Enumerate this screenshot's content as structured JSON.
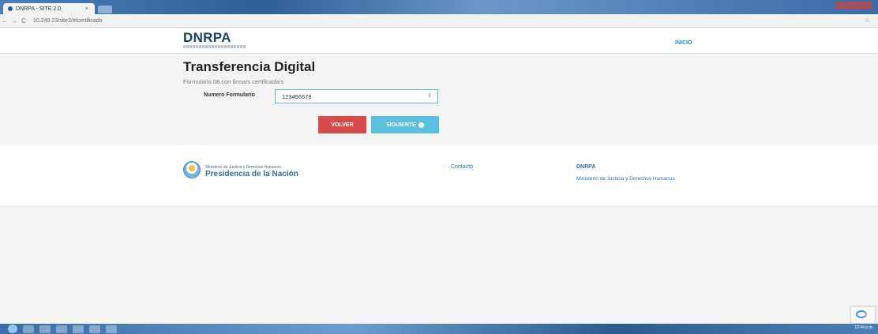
{
  "browser": {
    "tab_title": "DNRPA - SITE 2.0",
    "tab_close": "×",
    "url": "10.249.23/site2/#/certificado",
    "back": "←",
    "forward": "→",
    "reload": "C",
    "star": "☆"
  },
  "header": {
    "logo": "DNRPA",
    "nav_inicio": "INICIO"
  },
  "main": {
    "title": "Transferencia Digital",
    "subtitle": "Formulario 08 con firma/s certificada/s",
    "field_label": "Numero Formulario",
    "field_value": "123456678",
    "spinner": "⇕",
    "btn_volver": "VOLVER",
    "btn_siguiente": "SIGUIENTE",
    "siguiente_icon": "›"
  },
  "footer": {
    "ministerio": "Ministerio de Justicia y Derechos Humanos",
    "presidencia": "Presidencia de la Nación",
    "contacto": "Contacto",
    "dnrpa": "DNRPA",
    "ministerio_link": "Ministerio de Justicia y Derechos Humanos"
  },
  "taskbar": {
    "clock": "12:44 p.m."
  },
  "colors": {
    "brand": "#1f3e6e",
    "link": "#2f6fa8",
    "danger": "#d94b4b",
    "info": "#5bc0de"
  }
}
